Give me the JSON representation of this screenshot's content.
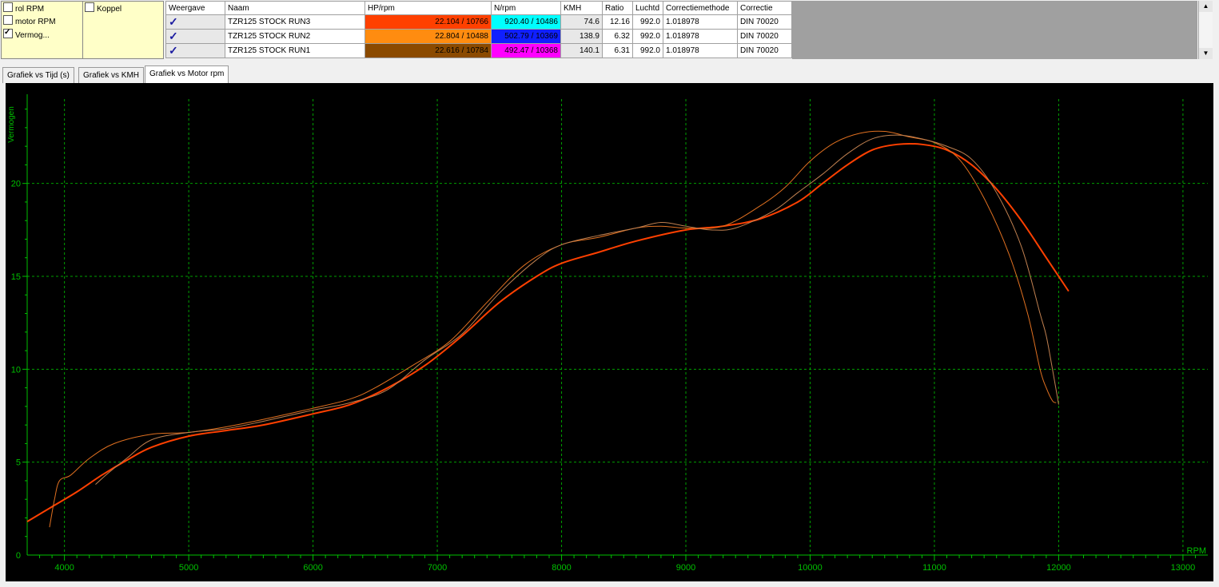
{
  "options": {
    "col1": [
      {
        "label": "rol RPM",
        "checked": false
      },
      {
        "label": "motor RPM",
        "checked": false
      },
      {
        "label": "Vermog...",
        "checked": true
      }
    ],
    "col2": [
      {
        "label": "Koppel",
        "checked": false
      }
    ]
  },
  "table": {
    "headers": [
      "Weergave",
      "Naam",
      "HP/rpm",
      "N/rpm",
      "KMH",
      "Ratio",
      "Luchtd",
      "Correctiemethode",
      "Correctie"
    ],
    "check_glyph": "✓",
    "rows": [
      {
        "name": "TZR125 STOCK RUN3",
        "hp": "22.104 / 10766",
        "hp_color": "#ff4000",
        "n": "920.40 / 10486",
        "n_color": "#00ffff",
        "kmh": "74.6",
        "ratio": "12.16",
        "luchtd": "992.0",
        "methode": "1.018978",
        "correctie": "DIN 70020"
      },
      {
        "name": "TZR125 STOCK RUN2",
        "hp": "22.804 / 10488",
        "hp_color": "#ff8c10",
        "n": "502.79 / 10369",
        "n_color": "#1020ff",
        "kmh": "138.9",
        "ratio": "6.32",
        "luchtd": "992.0",
        "methode": "1.018978",
        "correctie": "DIN 70020"
      },
      {
        "name": "TZR125 STOCK RUN1",
        "hp": "22.616 / 10784",
        "hp_color": "#8b4a00",
        "n": "492.47 / 10368",
        "n_color": "#ff00ff",
        "kmh": "140.1",
        "ratio": "6.31",
        "luchtd": "992.0",
        "methode": "1.018978",
        "correctie": "DIN 70020"
      }
    ]
  },
  "tabs": [
    "Grafiek vs Tijd (s)",
    "Grafiek vs KMH",
    "Grafiek vs Motor rpm"
  ],
  "active_tab": 2,
  "chart_data": {
    "type": "line",
    "ylabel": "Vermogen",
    "xlabel": "RPM",
    "xlim": [
      3700,
      13200
    ],
    "ylim": [
      0,
      24.8
    ],
    "xticks": [
      4000,
      5000,
      6000,
      7000,
      8000,
      9000,
      10000,
      11000,
      12000,
      13000
    ],
    "yticks": [
      0,
      5,
      10,
      15,
      20
    ],
    "grid": true,
    "background": "#000000",
    "axis_color": "#00c000",
    "grid_color": "#00a000",
    "series": [
      {
        "color": "#ff4000",
        "width": 2,
        "x": [
          3700,
          3900,
          4100,
          4300,
          4500,
          4700,
          5000,
          5300,
          5600,
          6000,
          6300,
          6600,
          6900,
          7200,
          7500,
          7800,
          8000,
          8300,
          8600,
          9000,
          9300,
          9600,
          9900,
          10100,
          10300,
          10500,
          10700,
          10900,
          11100,
          11300,
          11500,
          11700,
          11900,
          12080
        ],
        "y": [
          1.8,
          2.6,
          3.4,
          4.3,
          5.1,
          5.8,
          6.4,
          6.7,
          7.0,
          7.6,
          8.1,
          9.0,
          10.2,
          11.8,
          13.6,
          15.0,
          15.7,
          16.3,
          16.9,
          17.5,
          17.7,
          18.1,
          19.0,
          20.0,
          21.0,
          21.8,
          22.1,
          22.1,
          21.8,
          21.0,
          19.7,
          18.0,
          16.0,
          14.2
        ]
      },
      {
        "color": "#e07020",
        "width": 1,
        "x": [
          3880,
          3920,
          3960,
          4050,
          4200,
          4400,
          4700,
          5000,
          5300,
          5600,
          6000,
          6300,
          6500,
          6800,
          7100,
          7400,
          7700,
          8000,
          8300,
          8600,
          8800,
          9000,
          9300,
          9600,
          9800,
          10000,
          10200,
          10400,
          10600,
          10800,
          11000,
          11200,
          11400,
          11600,
          11750,
          11850,
          11900,
          11950,
          11980
        ],
        "y": [
          1.5,
          3.0,
          4.0,
          4.3,
          5.2,
          6.0,
          6.5,
          6.6,
          6.9,
          7.3,
          7.9,
          8.4,
          9.0,
          10.2,
          11.5,
          13.6,
          15.6,
          16.7,
          17.1,
          17.6,
          17.7,
          17.6,
          17.7,
          18.8,
          19.8,
          21.2,
          22.2,
          22.7,
          22.8,
          22.5,
          22.2,
          21.3,
          19.2,
          16.2,
          13.0,
          10.0,
          9.0,
          8.3,
          8.2
        ]
      },
      {
        "color": "#c08050",
        "width": 1,
        "x": [
          4250,
          4350,
          4500,
          4700,
          5000,
          5300,
          5600,
          6000,
          6300,
          6600,
          6900,
          7200,
          7500,
          7800,
          8000,
          8300,
          8600,
          8800,
          9000,
          9200,
          9400,
          9700,
          9900,
          10100,
          10300,
          10500,
          10700,
          10900,
          11100,
          11300,
          11500,
          11700,
          11850,
          11900,
          11950,
          12000
        ],
        "y": [
          3.8,
          4.4,
          5.2,
          6.2,
          6.6,
          6.8,
          7.2,
          7.8,
          8.2,
          8.9,
          10.5,
          11.9,
          14.1,
          15.9,
          16.7,
          17.2,
          17.6,
          17.9,
          17.7,
          17.5,
          17.6,
          18.5,
          19.5,
          20.5,
          21.6,
          22.4,
          22.6,
          22.4,
          22.0,
          21.3,
          19.5,
          16.6,
          13.0,
          11.8,
          10.0,
          8.1
        ]
      }
    ]
  }
}
